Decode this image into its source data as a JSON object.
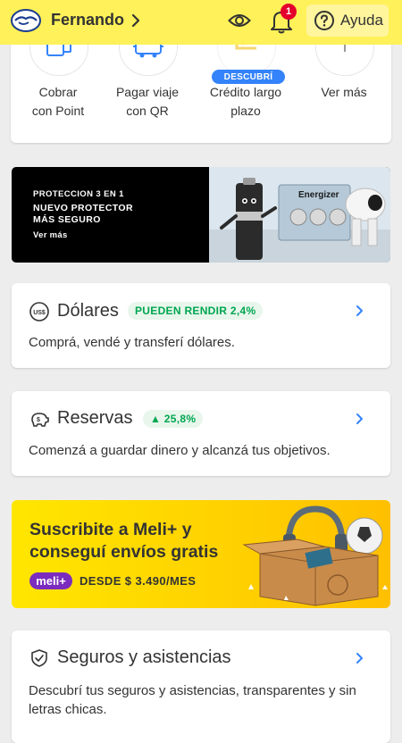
{
  "header": {
    "user_name": "Fernando",
    "notification_count": "1",
    "help_label": "Ayuda"
  },
  "shortcuts": {
    "items": [
      {
        "label_line1": "Cobrar",
        "label_line2": "con Point",
        "icon": "point-device-icon"
      },
      {
        "label_line1": "Pagar viaje",
        "label_line2": "con QR",
        "icon": "bus-qr-icon"
      },
      {
        "label_line1": "Crédito largo",
        "label_line2": "plazo",
        "icon": "credit-icon"
      },
      {
        "label_line1": "Ver más",
        "label_line2": "",
        "icon": "more-icon"
      }
    ],
    "badge": "DESCUBRÍ"
  },
  "promo": {
    "line1": "PROTECCION 3 EN 1",
    "line2": "NUEVO PROTECTOR",
    "line3": "MÁS SEGURO",
    "link": "Ver más",
    "brand": "Energizer"
  },
  "cards": {
    "dolares": {
      "title": "Dólares",
      "pill": "PUEDEN RENDIR 2,4%",
      "description": "Comprá, vendé y transferí dólares.",
      "icon": "us-dollar-icon"
    },
    "reservas": {
      "title": "Reservas",
      "pill": "▲ 25,8%",
      "description": "Comenzá a guardar dinero y alcanzá tus objetivos.",
      "icon": "piggy-bank-icon"
    },
    "seguros": {
      "title": "Seguros y asistencias",
      "description": "Descubrí tus seguros y asistencias, transparentes y sin letras chicas.",
      "icon": "shield-check-icon"
    }
  },
  "meli_banner": {
    "title_line1": "Suscribite a Meli+ y",
    "title_line2": "conseguí envíos gratis",
    "logo": "meli+",
    "price": "DESDE $ 3.490/MES"
  },
  "colors": {
    "header_bg": "#fff159",
    "accent_blue": "#3483fa",
    "green": "#00a650",
    "badge_red": "#e4002b",
    "meli_purple": "#7b2cbf"
  }
}
